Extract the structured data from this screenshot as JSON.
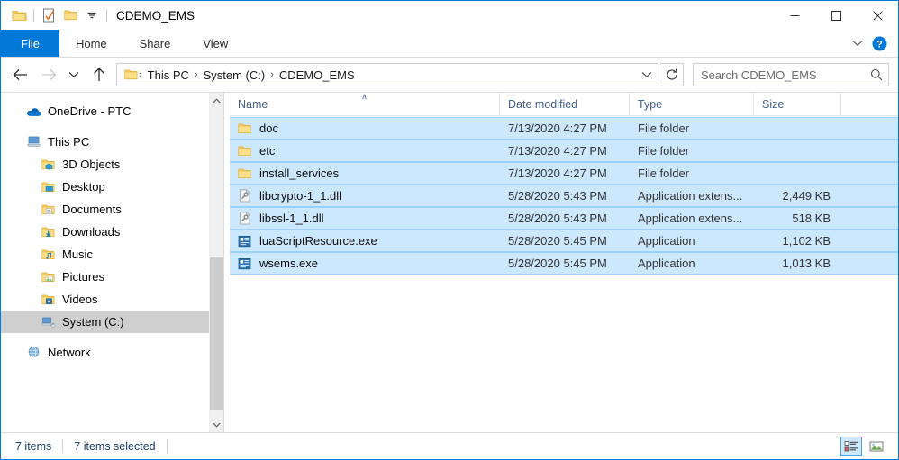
{
  "window": {
    "title": "CDEMO_EMS",
    "quick_access": [
      {
        "icon": "folder-icon",
        "name": "explorer-app-icon"
      },
      {
        "icon": "properties-icon",
        "name": "qat-properties"
      },
      {
        "icon": "new-folder-icon",
        "name": "qat-new-folder"
      },
      {
        "icon": "chevron-down-icon",
        "name": "qat-customize"
      }
    ],
    "controls": {
      "minimize": "—",
      "maximize": "☐",
      "close": "✕"
    }
  },
  "ribbon": {
    "tabs": [
      {
        "label": "File",
        "active_style": "file"
      },
      {
        "label": "Home"
      },
      {
        "label": "Share"
      },
      {
        "label": "View"
      }
    ],
    "expand_label": "∨",
    "help_label": "?"
  },
  "address": {
    "back_label": "←",
    "forward_label": "→",
    "recent_label": "∨",
    "up_label": "↑",
    "breadcrumbs": [
      "This PC",
      "System (C:)",
      "CDEMO_EMS"
    ],
    "separator": "›",
    "dropdown_label": "∨",
    "refresh_label": "↻"
  },
  "search": {
    "placeholder": "Search CDEMO_EMS",
    "value": "",
    "icon": "search-icon"
  },
  "sidebar": {
    "items": [
      {
        "label": "OneDrive - PTC",
        "icon": "onedrive-cloud-icon",
        "indent": false,
        "selected": false,
        "spacer_after": true
      },
      {
        "label": "This PC",
        "icon": "this-pc-icon",
        "indent": false,
        "selected": false
      },
      {
        "label": "3D Objects",
        "icon": "folder-3d-objects-icon",
        "indent": true,
        "selected": false
      },
      {
        "label": "Desktop",
        "icon": "folder-desktop-icon",
        "indent": true,
        "selected": false
      },
      {
        "label": "Documents",
        "icon": "folder-documents-icon",
        "indent": true,
        "selected": false
      },
      {
        "label": "Downloads",
        "icon": "folder-downloads-icon",
        "indent": true,
        "selected": false
      },
      {
        "label": "Music",
        "icon": "folder-music-icon",
        "indent": true,
        "selected": false
      },
      {
        "label": "Pictures",
        "icon": "folder-pictures-icon",
        "indent": true,
        "selected": false
      },
      {
        "label": "Videos",
        "icon": "folder-videos-icon",
        "indent": true,
        "selected": false
      },
      {
        "label": "System (C:)",
        "icon": "drive-icon",
        "indent": true,
        "selected": true,
        "spacer_after": true
      },
      {
        "label": "Network",
        "icon": "network-icon",
        "indent": false,
        "selected": false
      }
    ],
    "scroll_up": "∧",
    "scroll_down": "∨"
  },
  "filelist": {
    "columns": [
      {
        "label": "Name",
        "sorted": true,
        "sort_caret": "∧"
      },
      {
        "label": "Date modified",
        "sorted": false
      },
      {
        "label": "Type",
        "sorted": false
      },
      {
        "label": "Size",
        "sorted": false
      }
    ],
    "rows": [
      {
        "name": "doc",
        "date": "7/13/2020 4:27 PM",
        "type": "File folder",
        "size": "",
        "icon": "folder-icon",
        "selected": true
      },
      {
        "name": "etc",
        "date": "7/13/2020 4:27 PM",
        "type": "File folder",
        "size": "",
        "icon": "folder-icon",
        "selected": true
      },
      {
        "name": "install_services",
        "date": "7/13/2020 4:27 PM",
        "type": "File folder",
        "size": "",
        "icon": "folder-icon",
        "selected": true
      },
      {
        "name": "libcrypto-1_1.dll",
        "date": "5/28/2020 5:43 PM",
        "type": "Application extens...",
        "size": "2,449 KB",
        "icon": "dll-icon",
        "selected": true
      },
      {
        "name": "libssl-1_1.dll",
        "date": "5/28/2020 5:43 PM",
        "type": "Application extens...",
        "size": "518 KB",
        "icon": "dll-icon",
        "selected": true
      },
      {
        "name": "luaScriptResource.exe",
        "date": "5/28/2020 5:45 PM",
        "type": "Application",
        "size": "1,102 KB",
        "icon": "exe-icon",
        "selected": true
      },
      {
        "name": "wsems.exe",
        "date": "5/28/2020 5:45 PM",
        "type": "Application",
        "size": "1,013 KB",
        "icon": "exe-icon",
        "selected": true
      }
    ]
  },
  "statusbar": {
    "item_count": "7 items",
    "selection_count": "7 items selected",
    "views": [
      {
        "name": "details-view-button",
        "active": true
      },
      {
        "name": "large-icons-view-button",
        "active": false
      }
    ]
  },
  "colors": {
    "accent": "#0078d7",
    "selection": "#cce8ff",
    "nav_selection": "#cfcfcf",
    "folder_yellow": "#ffd149",
    "header_text": "#45618e"
  }
}
